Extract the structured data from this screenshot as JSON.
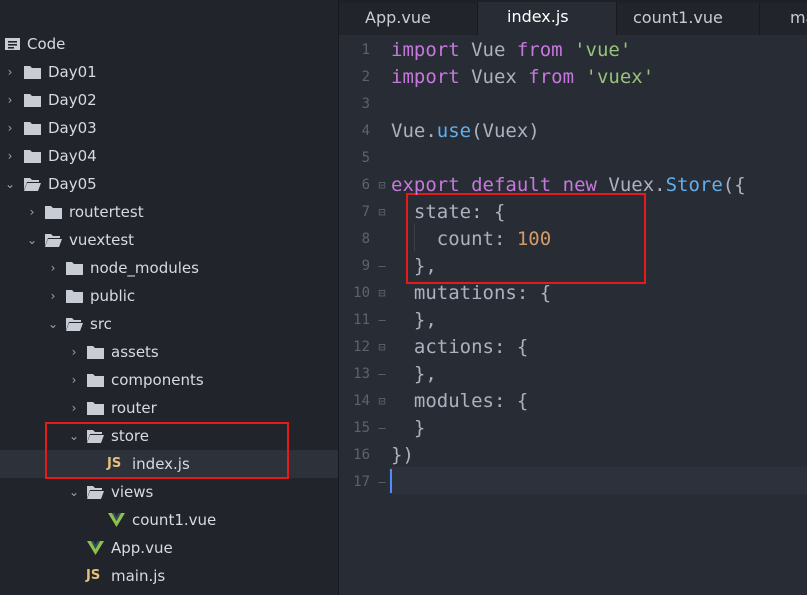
{
  "sidebar": {
    "root": "Code",
    "items": [
      {
        "label": "Day01"
      },
      {
        "label": "Day02"
      },
      {
        "label": "Day03"
      },
      {
        "label": "Day04"
      },
      {
        "label": "Day05"
      },
      {
        "label": "routertest"
      },
      {
        "label": "vuextest"
      },
      {
        "label": "node_modules"
      },
      {
        "label": "public"
      },
      {
        "label": "src"
      },
      {
        "label": "assets"
      },
      {
        "label": "components"
      },
      {
        "label": "router"
      },
      {
        "label": "store"
      },
      {
        "label": "index.js"
      },
      {
        "label": "views"
      },
      {
        "label": "count1.vue"
      },
      {
        "label": "App.vue"
      },
      {
        "label": "main.js"
      }
    ],
    "js_badge": "JS"
  },
  "tabs": [
    {
      "label": "App.vue"
    },
    {
      "label": "index.js"
    },
    {
      "label": "count1.vue"
    },
    {
      "label": "ma"
    }
  ],
  "editor": {
    "lines": [
      {
        "num": "1",
        "tokens": [
          {
            "t": "import",
            "c": "kw"
          },
          {
            "t": " Vue ",
            "c": "pl"
          },
          {
            "t": "from",
            "c": "kw"
          },
          {
            "t": " ",
            "c": "pl"
          },
          {
            "t": "'vue'",
            "c": "str"
          }
        ]
      },
      {
        "num": "2",
        "tokens": [
          {
            "t": "import",
            "c": "kw"
          },
          {
            "t": " Vuex ",
            "c": "pl"
          },
          {
            "t": "from",
            "c": "kw"
          },
          {
            "t": " ",
            "c": "pl"
          },
          {
            "t": "'vuex'",
            "c": "str"
          }
        ]
      },
      {
        "num": "3",
        "tokens": []
      },
      {
        "num": "4",
        "tokens": [
          {
            "t": "Vue.",
            "c": "pl"
          },
          {
            "t": "use",
            "c": "fn"
          },
          {
            "t": "(Vuex)",
            "c": "pl"
          }
        ]
      },
      {
        "num": "5",
        "tokens": []
      },
      {
        "num": "6",
        "tokens": [
          {
            "t": "export",
            "c": "kw"
          },
          {
            "t": " ",
            "c": "pl"
          },
          {
            "t": "default",
            "c": "kw"
          },
          {
            "t": " ",
            "c": "pl"
          },
          {
            "t": "new",
            "c": "kw"
          },
          {
            "t": " Vuex.",
            "c": "pl"
          },
          {
            "t": "Store",
            "c": "fn"
          },
          {
            "t": "({",
            "c": "pl"
          }
        ]
      },
      {
        "num": "7",
        "tokens": [
          {
            "t": "  state: {",
            "c": "pl"
          }
        ]
      },
      {
        "num": "8",
        "tokens": [
          {
            "t": "    count: ",
            "c": "pl"
          },
          {
            "t": "100",
            "c": "num"
          }
        ]
      },
      {
        "num": "9",
        "tokens": [
          {
            "t": "  },",
            "c": "pl"
          }
        ]
      },
      {
        "num": "10",
        "tokens": [
          {
            "t": "  mutations: {",
            "c": "pl"
          }
        ]
      },
      {
        "num": "11",
        "tokens": [
          {
            "t": "  },",
            "c": "pl"
          }
        ]
      },
      {
        "num": "12",
        "tokens": [
          {
            "t": "  actions: {",
            "c": "pl"
          }
        ]
      },
      {
        "num": "13",
        "tokens": [
          {
            "t": "  },",
            "c": "pl"
          }
        ]
      },
      {
        "num": "14",
        "tokens": [
          {
            "t": "  modules: {",
            "c": "pl"
          }
        ]
      },
      {
        "num": "15",
        "tokens": [
          {
            "t": "  }",
            "c": "pl"
          }
        ]
      },
      {
        "num": "16",
        "tokens": [
          {
            "t": "})",
            "c": "pl"
          }
        ]
      },
      {
        "num": "17",
        "tokens": []
      }
    ],
    "fold_open": "⊟",
    "fold_end": "–"
  },
  "colors": {
    "keyword": "#c678dd",
    "string": "#98c379",
    "function": "#61afef",
    "number": "#d19a66",
    "highlight_box": "#e51a1a"
  }
}
